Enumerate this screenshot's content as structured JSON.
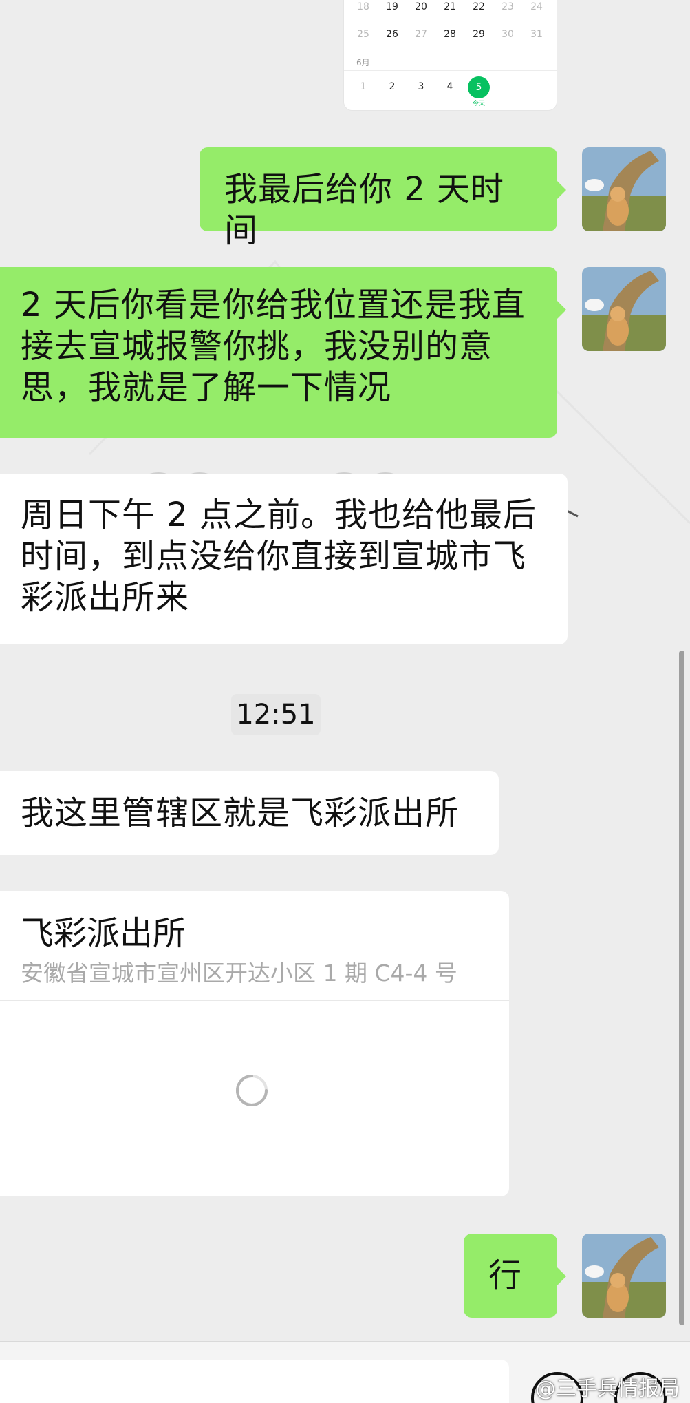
{
  "calendar": {
    "row1": [
      "18",
      "19",
      "20",
      "21",
      "22",
      "23",
      "24"
    ],
    "row2": [
      "25",
      "26",
      "27",
      "28",
      "29",
      "30",
      "31"
    ],
    "month_label": "6月",
    "row3": [
      "1",
      "2",
      "3",
      "4",
      "5"
    ],
    "today_label": "今天"
  },
  "messages": [
    {
      "side": "mine",
      "text": "我最后给你 2 天时间"
    },
    {
      "side": "mine",
      "text": "2 天后你看是你给我位置还是我直接去宣城报警你挑，我没别的意思，我就是了解一下情况"
    },
    {
      "side": "theirs",
      "text": "周日下午 2 点之前。我也给他最后时间，到点没给你直接到宣城市飞彩派出所来"
    },
    {
      "side": "theirs",
      "text": "我这里管辖区就是飞彩派出所"
    },
    {
      "side": "mine",
      "text": "行"
    }
  ],
  "timestamp": "12:51",
  "location": {
    "name": "飞彩派出所",
    "address": "安徽省宣城市宣州区开达小区 1 期 C4-4 号"
  },
  "watermark": "@三手兵情报局",
  "colors": {
    "background": "#ededed",
    "my_bubble": "#95ec69",
    "their_bubble": "#ffffff",
    "accent_green": "#07c160"
  }
}
